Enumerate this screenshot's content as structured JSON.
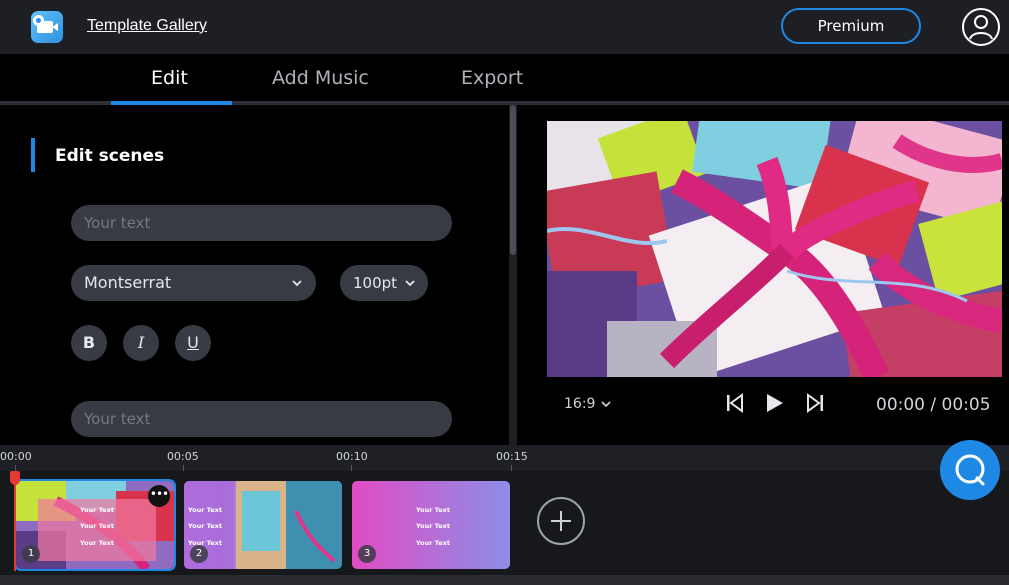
{
  "header": {
    "gallery_link": "Template Gallery",
    "premium_label": "Premium",
    "accent": "#1e88e5"
  },
  "tabs": [
    {
      "label": "Edit",
      "active": true
    },
    {
      "label": "Add Music",
      "active": false
    },
    {
      "label": "Export",
      "active": false
    }
  ],
  "edit_panel": {
    "section_title": "Edit scenes",
    "text_field_1": {
      "placeholder": "Your text",
      "value": ""
    },
    "font_select": {
      "value": "Montserrat"
    },
    "size_select": {
      "value": "100pt"
    },
    "format_buttons": [
      "B",
      "I",
      "U"
    ],
    "text_field_2": {
      "placeholder": "Your text",
      "value": ""
    }
  },
  "preview": {
    "aspect_ratio": "16:9",
    "time_readout": "00:00 / 00:05"
  },
  "timeline": {
    "ticks": [
      "00:00",
      "00:05",
      "00:10",
      "00:15"
    ],
    "clips": [
      {
        "number": "1",
        "texts": [
          "Your Text",
          "Your Text",
          "Your Text"
        ],
        "selected": true
      },
      {
        "number": "2",
        "texts": [
          "Your Text",
          "Your Text",
          "Your Text"
        ],
        "selected": false
      },
      {
        "number": "3",
        "texts": [
          "Your Text",
          "Your Text",
          "Your Text"
        ],
        "selected": false
      }
    ],
    "more_label": "•••"
  }
}
